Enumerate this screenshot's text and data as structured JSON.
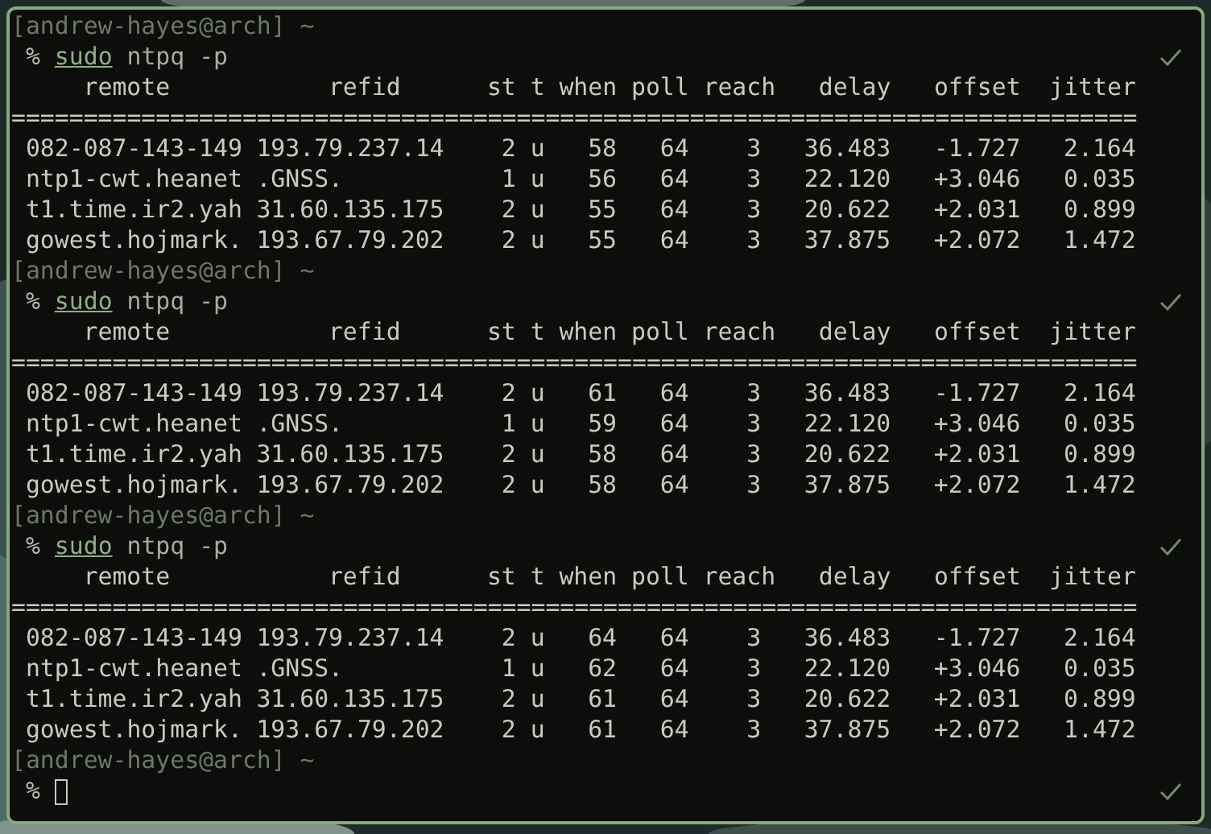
{
  "sessions": [
    {
      "prompt": "[andrew-hayes@arch] ~",
      "symbol": "%",
      "command": "sudo",
      "args": "ntpq -p",
      "succeeded": true,
      "columns": [
        "remote",
        "refid",
        "st",
        "t",
        "when",
        "poll",
        "reach",
        "delay",
        "offset",
        "jitter"
      ],
      "separator": "==============================================================================",
      "rows": [
        [
          "082-087-143-149",
          "193.79.237.14",
          "2",
          "u",
          "58",
          "64",
          "3",
          "36.483",
          "-1.727",
          "2.164"
        ],
        [
          "ntp1-cwt.heanet",
          ".GNSS.",
          "1",
          "u",
          "56",
          "64",
          "3",
          "22.120",
          "+3.046",
          "0.035"
        ],
        [
          "t1.time.ir2.yah",
          "31.60.135.175",
          "2",
          "u",
          "55",
          "64",
          "3",
          "20.622",
          "+2.031",
          "0.899"
        ],
        [
          "gowest.hojmark.",
          "193.67.79.202",
          "2",
          "u",
          "55",
          "64",
          "3",
          "37.875",
          "+2.072",
          "1.472"
        ]
      ]
    },
    {
      "prompt": "[andrew-hayes@arch] ~",
      "symbol": "%",
      "command": "sudo",
      "args": "ntpq -p",
      "succeeded": true,
      "columns": [
        "remote",
        "refid",
        "st",
        "t",
        "when",
        "poll",
        "reach",
        "delay",
        "offset",
        "jitter"
      ],
      "separator": "==============================================================================",
      "rows": [
        [
          "082-087-143-149",
          "193.79.237.14",
          "2",
          "u",
          "61",
          "64",
          "3",
          "36.483",
          "-1.727",
          "2.164"
        ],
        [
          "ntp1-cwt.heanet",
          ".GNSS.",
          "1",
          "u",
          "59",
          "64",
          "3",
          "22.120",
          "+3.046",
          "0.035"
        ],
        [
          "t1.time.ir2.yah",
          "31.60.135.175",
          "2",
          "u",
          "58",
          "64",
          "3",
          "20.622",
          "+2.031",
          "0.899"
        ],
        [
          "gowest.hojmark.",
          "193.67.79.202",
          "2",
          "u",
          "58",
          "64",
          "3",
          "37.875",
          "+2.072",
          "1.472"
        ]
      ]
    },
    {
      "prompt": "[andrew-hayes@arch] ~",
      "symbol": "%",
      "command": "sudo",
      "args": "ntpq -p",
      "succeeded": true,
      "columns": [
        "remote",
        "refid",
        "st",
        "t",
        "when",
        "poll",
        "reach",
        "delay",
        "offset",
        "jitter"
      ],
      "separator": "==============================================================================",
      "rows": [
        [
          "082-087-143-149",
          "193.79.237.14",
          "2",
          "u",
          "64",
          "64",
          "3",
          "36.483",
          "-1.727",
          "2.164"
        ],
        [
          "ntp1-cwt.heanet",
          ".GNSS.",
          "1",
          "u",
          "62",
          "64",
          "3",
          "22.120",
          "+3.046",
          "0.035"
        ],
        [
          "t1.time.ir2.yah",
          "31.60.135.175",
          "2",
          "u",
          "61",
          "64",
          "3",
          "20.622",
          "+2.031",
          "0.899"
        ],
        [
          "gowest.hojmark.",
          "193.67.79.202",
          "2",
          "u",
          "61",
          "64",
          "3",
          "37.875",
          "+2.072",
          "1.472"
        ]
      ]
    }
  ],
  "final": {
    "prompt": "[andrew-hayes@arch] ~",
    "symbol": "%",
    "cursor": true,
    "succeeded": true
  }
}
